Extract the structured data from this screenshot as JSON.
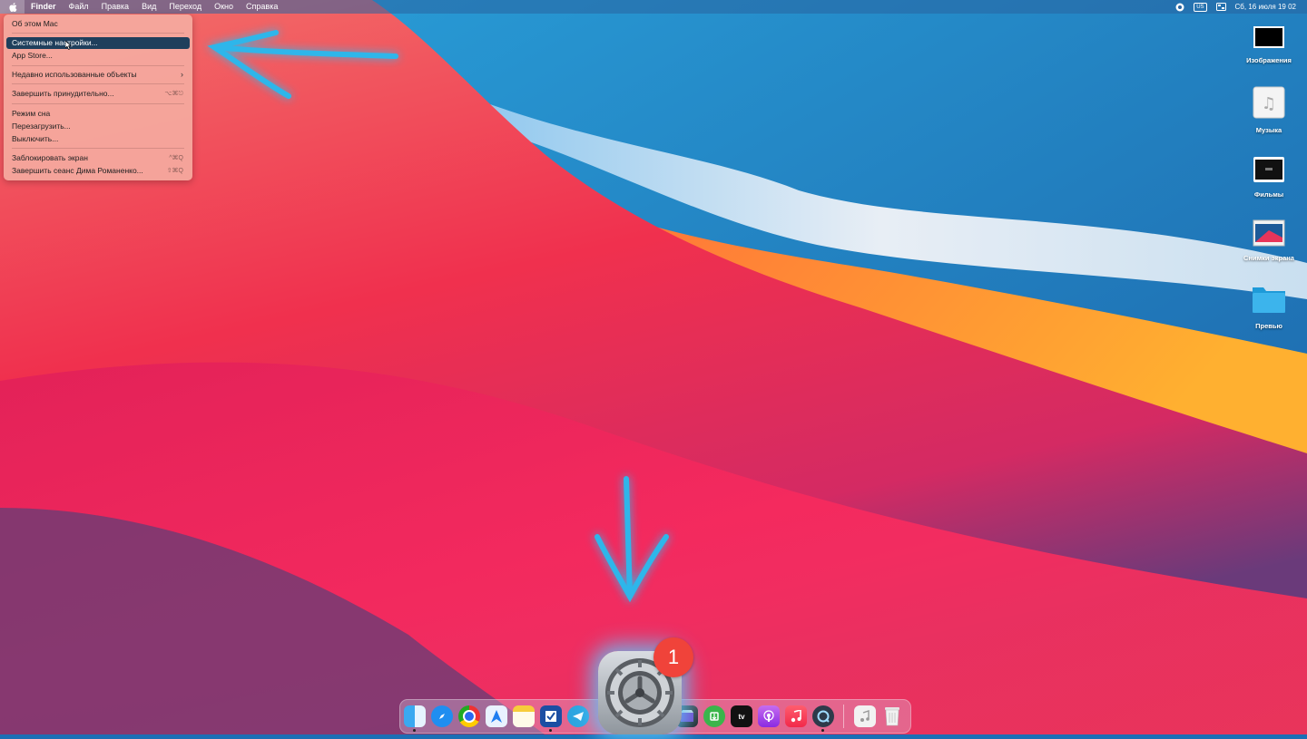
{
  "menubar": {
    "app_name": "Finder",
    "items": [
      "Файл",
      "Правка",
      "Вид",
      "Переход",
      "Окно",
      "Справка"
    ],
    "status": {
      "keyboard": "US",
      "clock": "Сб, 16 июля  19 02"
    }
  },
  "apple_menu": {
    "items": [
      {
        "label": "Об этом Mac",
        "shortcut": ""
      },
      {
        "label": "Системные настройки...",
        "shortcut": "",
        "highlighted": true
      },
      {
        "label": "App Store...",
        "shortcut": ""
      },
      {
        "label": "Недавно использованные объекты",
        "shortcut": "›"
      },
      {
        "label": "Завершить принудительно...",
        "shortcut": "⌥⌘⎋"
      },
      {
        "label": "Режим сна",
        "shortcut": ""
      },
      {
        "label": "Перезагрузить...",
        "shortcut": ""
      },
      {
        "label": "Выключить...",
        "shortcut": ""
      },
      {
        "label": "Заблокировать экран",
        "shortcut": "^⌘Q"
      },
      {
        "label": "Завершить сеанс Дима Романенко...",
        "shortcut": "⇧⌘Q"
      }
    ]
  },
  "desktop_icons": [
    {
      "name": "Изображения"
    },
    {
      "name": "Музыка"
    },
    {
      "name": "Фильмы"
    },
    {
      "name": "Снимки экрана"
    },
    {
      "name": "Превью"
    }
  ],
  "dock": {
    "badge_count": "1",
    "apps": [
      "finder",
      "safari",
      "chrome",
      "maps-nav",
      "notes",
      "tasks",
      "telegram",
      "settings",
      "imovie",
      "downloader",
      "apple-tv",
      "podcasts",
      "music",
      "quicktime",
      "music-doc",
      "trash"
    ],
    "appletv_label": "tv"
  },
  "colors": {
    "highlight": "#1f3f5c",
    "badge": "#f0433a",
    "arrow": "#2fb6ea"
  }
}
